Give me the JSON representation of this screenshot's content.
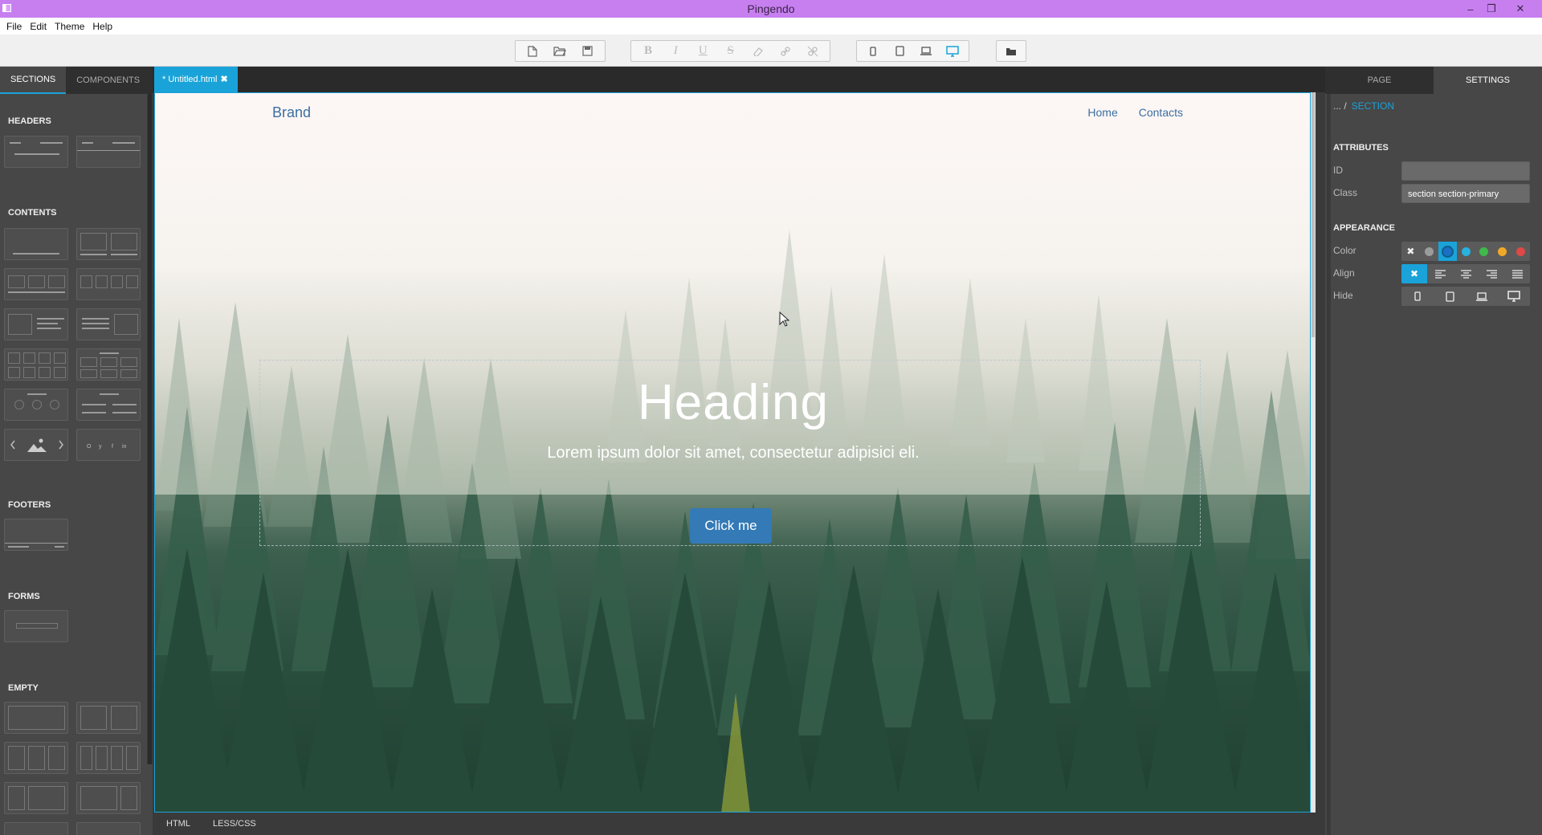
{
  "window": {
    "title": "Pingendo"
  },
  "menu": [
    "File",
    "Edit",
    "Theme",
    "Help"
  ],
  "left_panel": {
    "tabs": [
      "SECTIONS",
      "COMPONENTS"
    ],
    "active_tab": "SECTIONS",
    "categories": {
      "headers": "HEADERS",
      "contents": "CONTENTS",
      "footers": "FOOTERS",
      "forms": "FORMS",
      "empty": "EMPTY"
    }
  },
  "editor": {
    "file_tab": "* Untitled.html",
    "bottom_tabs": [
      "HTML",
      "LESS/CSS"
    ]
  },
  "site": {
    "brand": "Brand",
    "nav": [
      "Home",
      "Contacts"
    ],
    "heading": "Heading",
    "subheading": "Lorem ipsum dolor sit amet, consectetur adipisici eli.",
    "button": "Click me"
  },
  "right_panel": {
    "tabs": [
      "PAGE",
      "SETTINGS"
    ],
    "active_tab": "SETTINGS",
    "breadcrumb_prefix": "... /",
    "breadcrumb_current": "SECTION",
    "attributes_header": "ATTRIBUTES",
    "id_label": "ID",
    "id_value": "",
    "class_label": "Class",
    "class_value": "section section-primary",
    "appearance_header": "APPEARANCE",
    "color_label": "Color",
    "colors": [
      "#9b9b9b",
      "#1b6fc4",
      "#27b2e0",
      "#3fb94a",
      "#f0a828",
      "#e04848"
    ],
    "selected_color_index": 1,
    "align_label": "Align",
    "hide_label": "Hide"
  },
  "accent_color": "#1aa3d9",
  "title_bar_color": "#c77ff0"
}
